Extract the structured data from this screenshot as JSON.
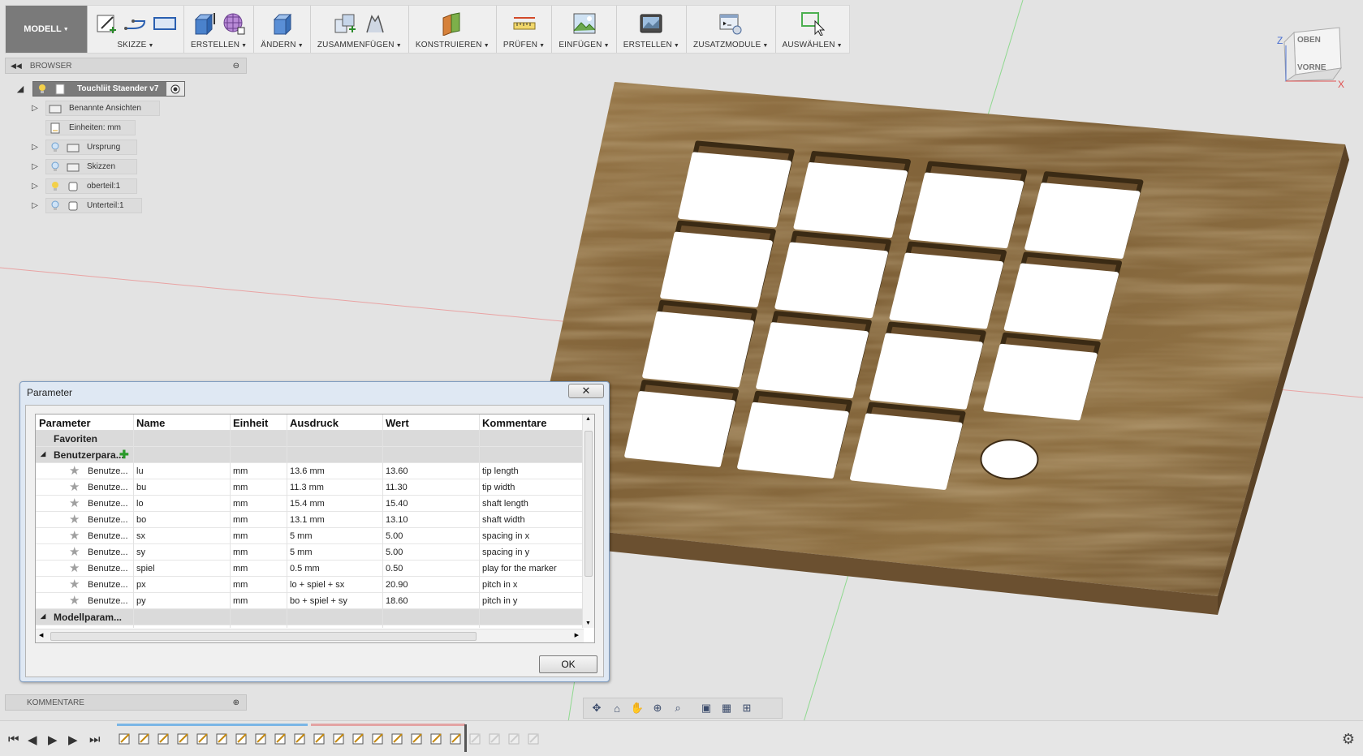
{
  "toolbar": {
    "workspace": "MODELL",
    "groups": [
      {
        "label": "SKIZZE"
      },
      {
        "label": "ERSTELLEN"
      },
      {
        "label": "ÄNDERN"
      },
      {
        "label": "ZUSAMMENFÜGEN"
      },
      {
        "label": "KONSTRUIEREN"
      },
      {
        "label": "PRÜFEN"
      },
      {
        "label": "EINFÜGEN"
      },
      {
        "label": "ERSTELLEN"
      },
      {
        "label": "ZUSATZMODULE"
      },
      {
        "label": "AUSWÄHLEN"
      }
    ]
  },
  "browser": {
    "title": "BROWSER",
    "root": "Touchliit Staender v7",
    "items": [
      {
        "label": "Benannte Ansichten"
      },
      {
        "label": "Einheiten: mm"
      },
      {
        "label": "Ursprung"
      },
      {
        "label": "Skizzen"
      },
      {
        "label": "oberteil:1"
      },
      {
        "label": "Unterteil:1"
      }
    ]
  },
  "viewcube": {
    "top": "OBEN",
    "front": "VORNE",
    "z": "Z",
    "x": "X"
  },
  "dialog": {
    "title": "Parameter",
    "close": "✕",
    "ok": "OK",
    "columns": [
      "Parameter",
      "Name",
      "Einheit",
      "Ausdruck",
      "Wert",
      "Kommentare"
    ],
    "favorites": "Favoriten",
    "user_group": "Benutzerpara...",
    "model_group": "Modellparam...",
    "rows": [
      {
        "param": "Benutze...",
        "name": "lu",
        "unit": "mm",
        "expr": "13.6 mm",
        "value": "13.60",
        "comment": "tip length"
      },
      {
        "param": "Benutze...",
        "name": "bu",
        "unit": "mm",
        "expr": "11.3 mm",
        "value": "11.30",
        "comment": "tip width"
      },
      {
        "param": "Benutze...",
        "name": "lo",
        "unit": "mm",
        "expr": "15.4 mm",
        "value": "15.40",
        "comment": "shaft length"
      },
      {
        "param": "Benutze...",
        "name": "bo",
        "unit": "mm",
        "expr": "13.1 mm",
        "value": "13.10",
        "comment": "shaft width"
      },
      {
        "param": "Benutze...",
        "name": "sx",
        "unit": "mm",
        "expr": "5 mm",
        "value": "5.00",
        "comment": "spacing in x"
      },
      {
        "param": "Benutze...",
        "name": "sy",
        "unit": "mm",
        "expr": "5 mm",
        "value": "5.00",
        "comment": "spacing in y"
      },
      {
        "param": "Benutze...",
        "name": "spiel",
        "unit": "mm",
        "expr": "0.5 mm",
        "value": "0.50",
        "comment": "play for the marker"
      },
      {
        "param": "Benutze...",
        "name": "px",
        "unit": "mm",
        "expr": "lo + spiel + sx",
        "value": "20.90",
        "comment": "pitch in x"
      },
      {
        "param": "Benutze...",
        "name": "py",
        "unit": "mm",
        "expr": "bo + spiel + sy",
        "value": "18.60",
        "comment": "pitch in y"
      }
    ]
  },
  "comments_panel": {
    "title": "KOMMENTARE"
  },
  "colors": {
    "wood": "#8a6a3e",
    "wood_dark": "#5e4526",
    "accent": "#0a6fc2",
    "axis_red": "#e07070",
    "axis_green": "#6ccf6c"
  }
}
